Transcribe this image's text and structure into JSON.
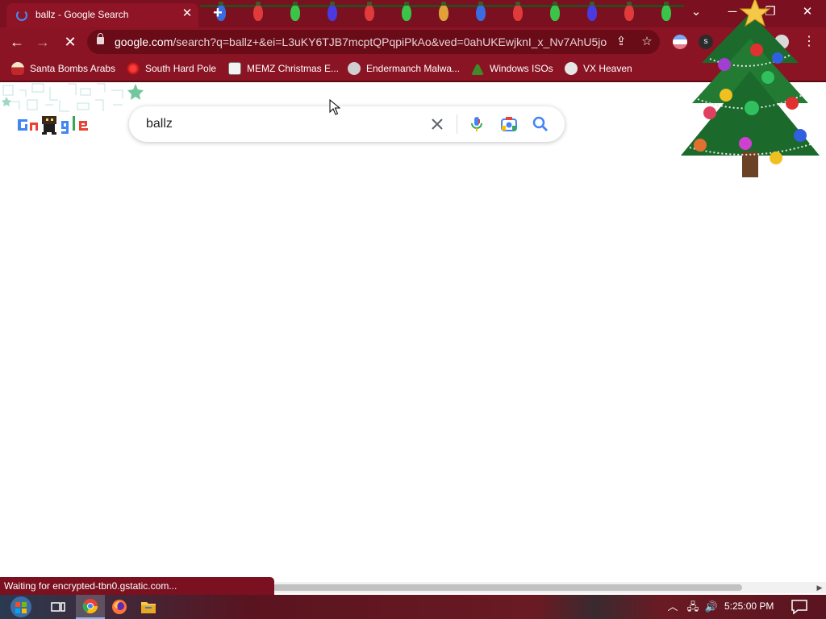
{
  "tab": {
    "title": "ballz - Google Search"
  },
  "window_controls": {
    "dropdown": "⌄",
    "minimize": "─",
    "restore": "❐",
    "close": "✕"
  },
  "omnibox": {
    "domain": "google.com",
    "path": "/search?q=ballz+&ei=L3uKY6TJB7mcptQPqpiPkAo&ved=0ahUKEwjknI_x_Nv7AhU5jo..."
  },
  "extensions": {
    "s_label": "s"
  },
  "bookmarks": [
    {
      "label": "Santa Bombs Arabs",
      "icon": "santa-icon"
    },
    {
      "label": "South Hard Pole",
      "icon": "red-snowflake-icon"
    },
    {
      "label": "MEMZ Christmas E...",
      "icon": "memz-icon"
    },
    {
      "label": "Endermanch Malwa...",
      "icon": "endermanch-icon"
    },
    {
      "label": "Windows ISOs",
      "icon": "tree-icon"
    },
    {
      "label": "VX Heaven",
      "icon": "vx-icon"
    }
  ],
  "search": {
    "query": "ballz"
  },
  "status": {
    "text": "Waiting for encrypted-tbn0.gstatic.com..."
  },
  "taskbar": {
    "time": "5:25:00 PM"
  },
  "colors": {
    "chrome_frame": "#7a1020",
    "toolbar": "#8a1424",
    "google_blue": "#4285f4",
    "google_red": "#ea4335",
    "google_yellow": "#fbbc04",
    "google_green": "#34a853"
  }
}
